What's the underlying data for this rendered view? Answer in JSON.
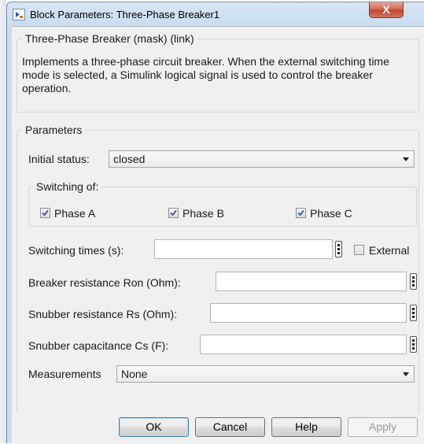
{
  "window": {
    "title": "Block Parameters: Three-Phase Breaker1",
    "close_glyph": "X"
  },
  "block": {
    "name": "Three-Phase Breaker (mask) (link)",
    "description": "Implements a three-phase circuit breaker. When the external switching time mode is selected, a Simulink logical signal is used to control the breaker operation."
  },
  "parameters": {
    "section_label": "Parameters",
    "initial_status": {
      "label": "Initial status:",
      "value": "closed"
    },
    "switching_of": {
      "label": "Switching of:",
      "phases": [
        {
          "label": "Phase A",
          "checked": true
        },
        {
          "label": "Phase B",
          "checked": true
        },
        {
          "label": "Phase C",
          "checked": true
        }
      ]
    },
    "switching_times": {
      "label": "Switching times (s):",
      "value": ""
    },
    "external": {
      "label": "External",
      "checked": false
    },
    "breaker_resistance": {
      "label": "Breaker resistance Ron (Ohm):",
      "value": ""
    },
    "snubber_resistance": {
      "label": "Snubber resistance Rs (Ohm):",
      "value": ""
    },
    "snubber_capacitance": {
      "label": "Snubber capacitance Cs (F):",
      "value": ""
    },
    "measurements": {
      "label": "Measurements",
      "value": "None"
    }
  },
  "buttons": {
    "ok": "OK",
    "cancel": "Cancel",
    "help": "Help",
    "apply": "Apply"
  },
  "colors": {
    "title_gradient": "#c9dcef",
    "client_bg": "#f0f0f0",
    "close_button": "#c0442a",
    "checkmark": "#2a55b8"
  }
}
